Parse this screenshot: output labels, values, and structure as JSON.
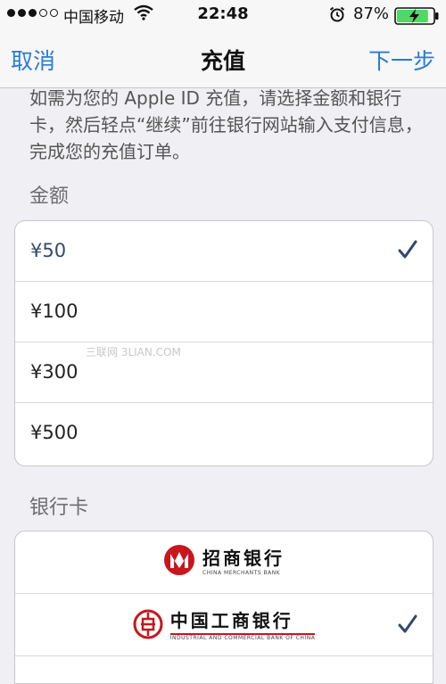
{
  "status": {
    "carrier": "中国移动",
    "time": "22:48",
    "battery_pct": "87%",
    "battery_level": 0.87,
    "signal_bars": 3,
    "signal_total": 5
  },
  "nav": {
    "cancel": "取消",
    "title": "充值",
    "next": "下一步"
  },
  "intro": "如需为您的 Apple ID 充值，请选择金额和银行卡，然后轻点“继续”前往银行网站输入支付信息，完成您的充值订单。",
  "amount": {
    "label": "金额",
    "options": [
      {
        "text": "¥50",
        "selected": true
      },
      {
        "text": "¥100",
        "selected": false
      },
      {
        "text": "¥300",
        "selected": false
      },
      {
        "text": "¥500",
        "selected": false
      }
    ]
  },
  "bank": {
    "label": "银行卡",
    "options": [
      {
        "name": "招商银行",
        "sub": "CHINA MERCHANTS BANK",
        "selected": false
      },
      {
        "name": "中国工商银行",
        "sub": "INDUSTRIAL AND COMMERCIAL BANK OF CHINA",
        "selected": true
      }
    ]
  },
  "watermark": "三联网 3LIAN.COM",
  "colors": {
    "accent": "#2a7bd3",
    "check": "#33496b",
    "cmb_red": "#c7161e",
    "icbc_red": "#c7161e",
    "battery_green": "#4cd964"
  }
}
